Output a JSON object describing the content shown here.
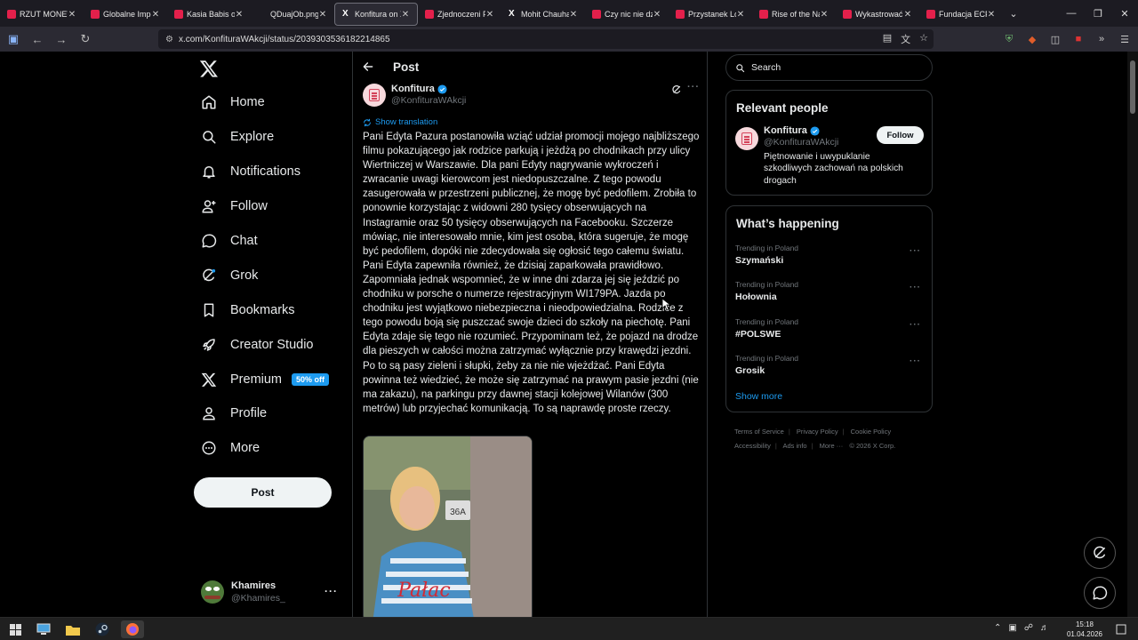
{
  "browser": {
    "tabs": [
      {
        "label": "RZUT MONETĄ",
        "icon": "youtube-icon",
        "active": false
      },
      {
        "label": "Globalne Imperi",
        "icon": "youtube-icon",
        "active": false
      },
      {
        "label": "Kasia Babis oma",
        "icon": "youtube-icon",
        "active": false
      },
      {
        "label": "QDuajOb.png (obra",
        "icon": "image-icon",
        "active": false
      },
      {
        "label": "Konfitura on X:",
        "icon": "x-icon",
        "active": true
      },
      {
        "label": "Zjednoczeni Pra",
        "icon": "youtube-icon",
        "active": false
      },
      {
        "label": "Mohit Chauhan",
        "icon": "x-icon",
        "active": false
      },
      {
        "label": "Czy nic nie dziej",
        "icon": "youtube-icon",
        "active": false
      },
      {
        "label": "Przystanek Lomi",
        "icon": "youtube-icon",
        "active": false
      },
      {
        "label": "Rise of the Nazi",
        "icon": "youtube-icon",
        "active": false
      },
      {
        "label": "Wykastrować bi",
        "icon": "youtube-icon",
        "active": false
      },
      {
        "label": "Fundacja ECPU |",
        "icon": "youtube-icon",
        "active": false
      }
    ],
    "url": "x.com/KonfituraWAkcji/status/2039303536182214865"
  },
  "sidebar": {
    "items": [
      {
        "label": "Home",
        "icon": "home-icon"
      },
      {
        "label": "Explore",
        "icon": "search-icon"
      },
      {
        "label": "Notifications",
        "icon": "bell-icon"
      },
      {
        "label": "Follow",
        "icon": "person-plus-icon"
      },
      {
        "label": "Chat",
        "icon": "chat-bubble-icon"
      },
      {
        "label": "Grok",
        "icon": "grok-icon"
      },
      {
        "label": "Bookmarks",
        "icon": "bookmark-icon"
      },
      {
        "label": "Creator Studio",
        "icon": "rocket-icon"
      },
      {
        "label": "Premium",
        "icon": "x-logo-icon",
        "badge": "50% off"
      },
      {
        "label": "Profile",
        "icon": "person-icon"
      },
      {
        "label": "More",
        "icon": "more-circle-icon"
      }
    ],
    "post_label": "Post",
    "account": {
      "name": "Khamires",
      "handle": "@Khamires_"
    }
  },
  "post": {
    "header_title": "Post",
    "author_name": "Konfitura",
    "author_handle": "@KonfituraWAkcji",
    "show_translation": "Show translation",
    "text": "Pani Edyta Pazura postanowiła wziąć udział promocji mojego najbliższego filmu pokazującego jak rodzice parkują i jeżdżą po chodnikach przy ulicy Wiertniczej w Warszawie. Dla pani Edyty nagrywanie wykroczeń i zwracanie uwagi kierowcom jest niedopuszczalne. Z tego powodu zasugerowała w przestrzeni publicznej, że mogę być pedofilem. Zrobiła to ponownie korzystając z widowni 280 tysięcy obserwujących na Instagramie oraz 50 tysięcy obserwujących na Facebooku. Szczerze mówiąc, nie interesowało mnie, kim jest osoba, która sugeruje, że mogę być pedofilem, dopóki nie zdecydowała się ogłosić tego całemu światu. Pani Edyta zapewniła również, że dzisiaj zaparkowała prawidłowo. Zapomniała jednak wspomnieć, że w inne dni zdarza jej się jeździć po chodniku w porsche o numerze rejestracyjnym WI179PA. Jazda po chodniku jest wyjątkowo niebezpieczna i nieodpowiedzialna. Rodzice z tego powodu boją się puszczać swoje dzieci do szkoły na piechotę. Pani Edyta zdaje się tego nie rozumieć. Przypominam też, że pojazd na drodze dla pieszych w całości można zatrzymać wyłącznie przy krawędzi jezdni. Po to są pasy zieleni i słupki, żeby za nie nie wjeżdżać. Pani Edyta powinna też wiedzieć, że może się zatrzymać na prawym pasie jezdni (nie ma zakazu), na parkingu przy dawnej stacji kolejowej Wilanów (300 metrów) lub przyjechać komunikacją. To są naprawdę proste rzeczy.",
    "media_sign_text": "36A"
  },
  "right": {
    "search_placeholder": "Search",
    "relevant_title": "Relevant people",
    "relevant_person": {
      "name": "Konfitura",
      "handle": "@KonfituraWAkcji",
      "bio": "Piętnowanie i uwypuklanie szkodliwych zachowań na polskich drogach",
      "follow_label": "Follow"
    },
    "happening_title": "What’s happening",
    "trends": [
      {
        "category": "Trending in Poland",
        "name": "Szymański"
      },
      {
        "category": "Trending in Poland",
        "name": "Hołownia"
      },
      {
        "category": "Trending in Poland",
        "name": "#POLSWE"
      },
      {
        "category": "Trending in Poland",
        "name": "Grosik"
      }
    ],
    "show_more": "Show more",
    "footer": {
      "terms": "Terms of Service",
      "privacy": "Privacy Policy",
      "cookie": "Cookie Policy",
      "accessibility": "Accessibility",
      "ads": "Ads info",
      "more": "More ···",
      "copyright": "© 2026 X Corp."
    }
  },
  "taskbar": {
    "time": "15:18",
    "date": "01.04.2026"
  },
  "colors": {
    "accent": "#1d9bf0",
    "background": "#000000",
    "border": "#2f3336",
    "muted": "#71767b"
  }
}
